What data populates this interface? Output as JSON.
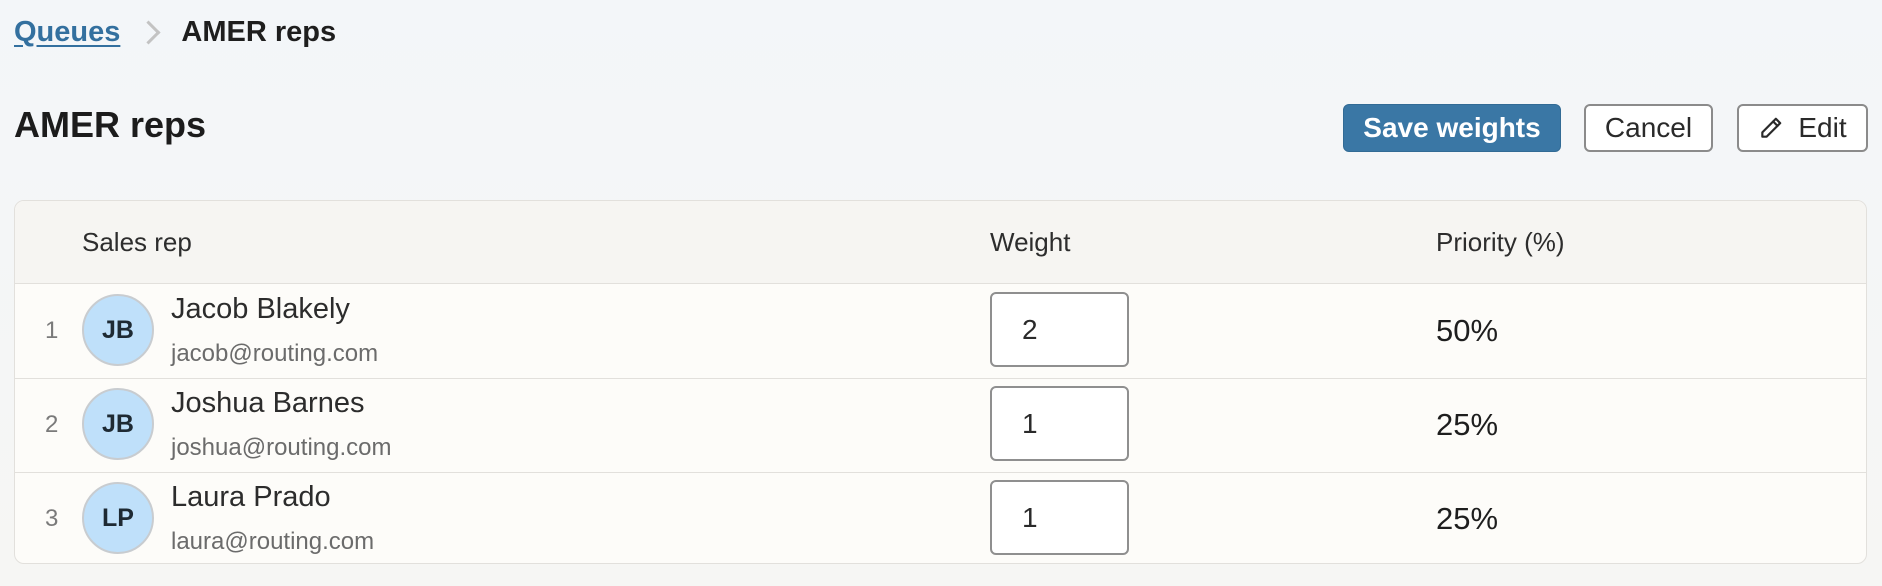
{
  "breadcrumb": {
    "parent": "Queues",
    "current": "AMER reps"
  },
  "page": {
    "title": "AMER reps"
  },
  "actions": {
    "save": "Save weights",
    "cancel": "Cancel",
    "edit": "Edit"
  },
  "table": {
    "columns": {
      "rep": "Sales rep",
      "weight": "Weight",
      "priority": "Priority (%)"
    },
    "rows": [
      {
        "num": "1",
        "initials": "JB",
        "name": "Jacob Blakely",
        "email": "jacob@routing.com",
        "weight": "2",
        "priority": "50%"
      },
      {
        "num": "2",
        "initials": "JB",
        "name": "Joshua Barnes",
        "email": "joshua@routing.com",
        "weight": "1",
        "priority": "25%"
      },
      {
        "num": "3",
        "initials": "LP",
        "name": "Laura Prado",
        "email": "laura@routing.com",
        "weight": "1",
        "priority": "25%"
      }
    ]
  },
  "colors": {
    "primary": "#3a77a5",
    "link": "#33709f",
    "avatar_bg": "#bfe0fa"
  },
  "icons": {
    "edit": "pencil-icon",
    "breadcrumb_separator": "chevron-right-icon"
  }
}
